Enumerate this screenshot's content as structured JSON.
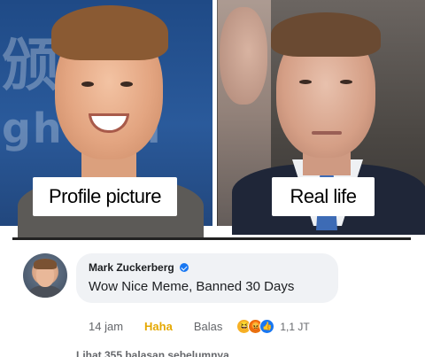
{
  "captions": {
    "left": "Profile picture",
    "right": "Real life"
  },
  "background_text": {
    "row1": "颁 委",
    "row2": "gh Stu"
  },
  "comment": {
    "author": "Mark Zuckerberg",
    "text": "Wow Nice Meme, Banned 30 Days",
    "time": "14 jam",
    "reaction_action": "Haha",
    "reply_action": "Balas",
    "reaction_count": "1,1 JT",
    "reaction_icons": [
      "haha-emoji-icon",
      "angry-emoji-icon",
      "like-icon"
    ],
    "more_replies": "Lihat 355 balasan sebelumnya"
  },
  "colors": {
    "haha_accent": "#e5a800",
    "verified_badge": "#1877f2",
    "bubble_bg": "#f0f2f5",
    "meta_text": "#65676b"
  }
}
